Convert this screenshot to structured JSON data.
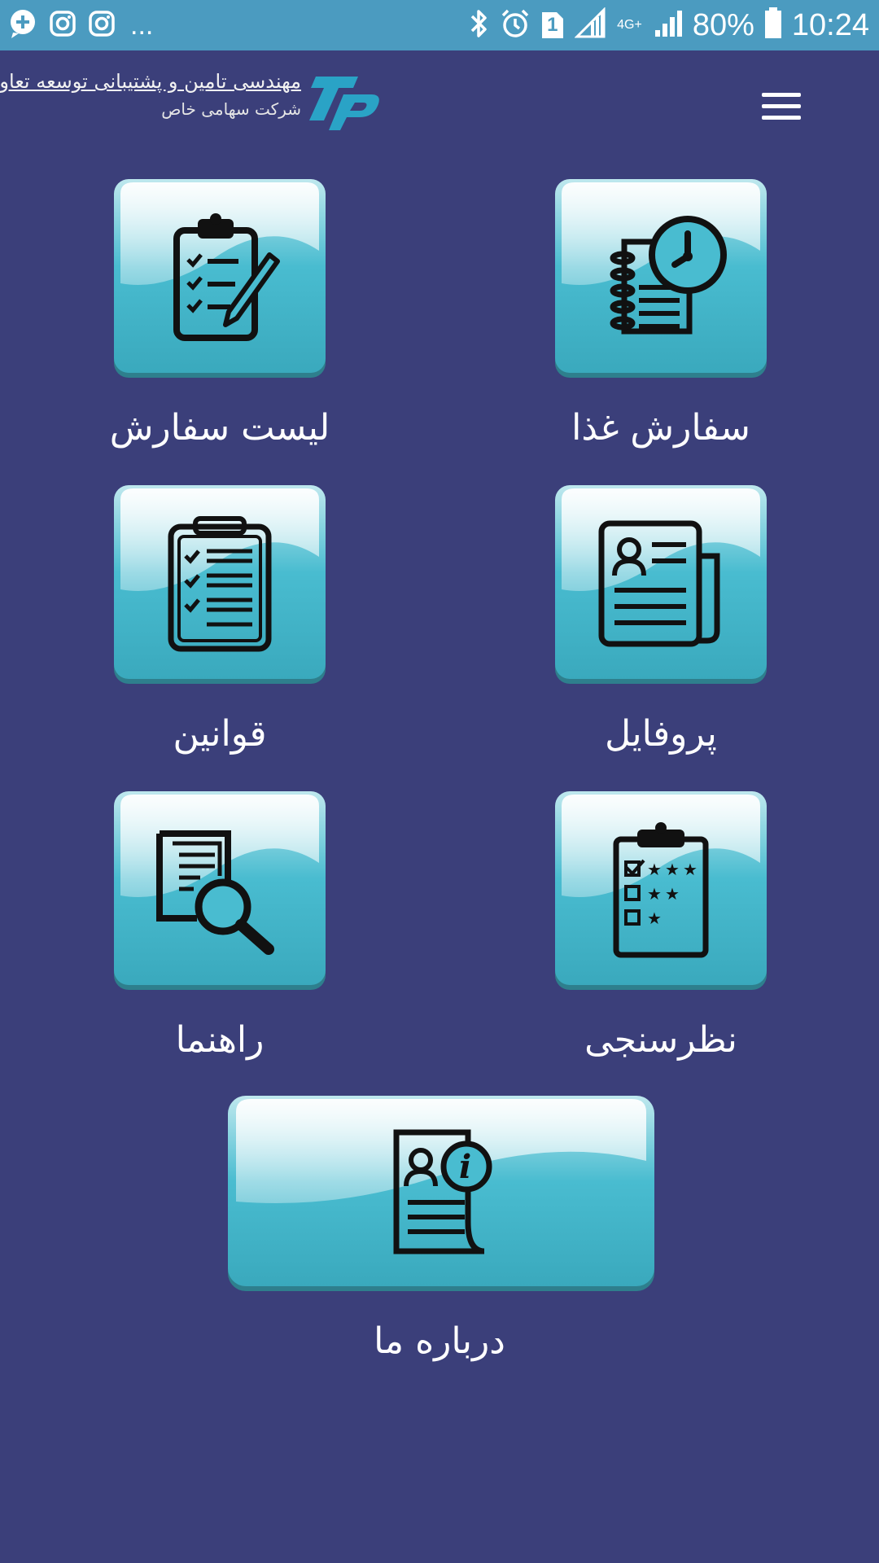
{
  "status_bar": {
    "overflow": "...",
    "battery_percent": "80%",
    "time": "10:24",
    "network": "4G+",
    "sim": "1",
    "icons_left": [
      "chat-plus-icon",
      "instagram-icon",
      "instagram-icon"
    ],
    "icons_right": [
      "bluetooth-icon",
      "alarm-icon",
      "sim-icon",
      "signal-icon",
      "signal-icon",
      "battery-icon"
    ]
  },
  "header": {
    "logo_title": "مهندسی تامین و پشتیبانی توسعه تعاون",
    "logo_subtitle": "شرکت سهامی خاص",
    "logo_mark": "tp",
    "menu_icon": "hamburger-menu-icon"
  },
  "tiles": [
    {
      "label": "سفارش غذا",
      "icon": "food-order-clock-icon"
    },
    {
      "label": "لیست سفارش",
      "icon": "clipboard-checklist-pen-icon"
    },
    {
      "label": "پروفایل",
      "icon": "profile-document-icon"
    },
    {
      "label": "قوانین",
      "icon": "clipboard-rules-icon"
    },
    {
      "label": "نظرسنجی",
      "icon": "survey-clipboard-stars-icon"
    },
    {
      "label": "راهنما",
      "icon": "document-search-icon"
    },
    {
      "label": "درباره ما",
      "icon": "about-info-document-icon"
    }
  ],
  "colors": {
    "background": "#3b3f7a",
    "status_bar": "#4b9bc0",
    "tile": "#3fb6c8",
    "icon": "#1a1a1a",
    "label": "#ffffff"
  }
}
